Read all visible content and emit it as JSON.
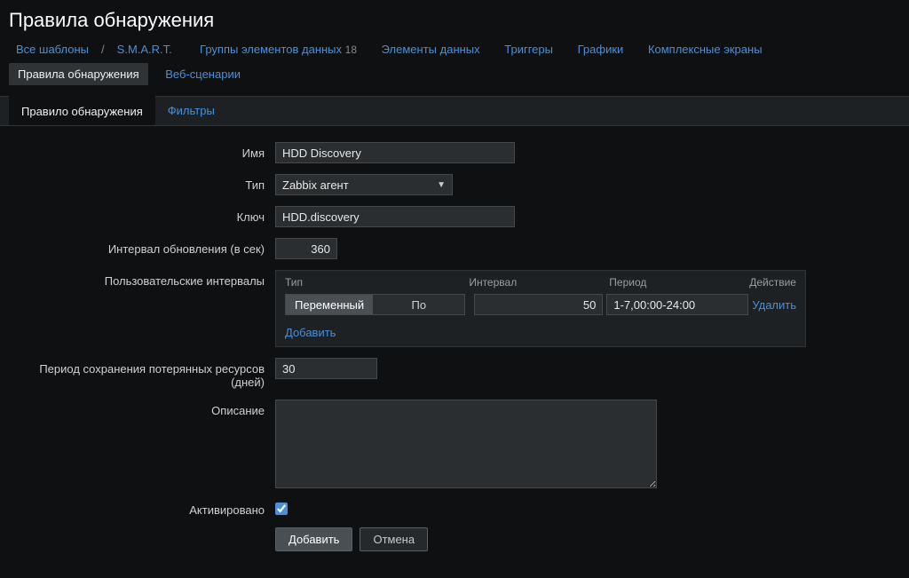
{
  "page": {
    "title": "Правила обнаружения"
  },
  "breadcrumb": {
    "all_templates": "Все шаблоны",
    "template_name": "S.M.A.R.T.",
    "data_groups": "Группы элементов данных",
    "data_groups_count": "18",
    "data_items": "Элементы данных",
    "triggers": "Триггеры",
    "graphs": "Графики",
    "screens": "Комплексные экраны",
    "discovery_rules": "Правила обнаружения",
    "web": "Веб-сценарии"
  },
  "tabs": {
    "rule": "Правило обнаружения",
    "filters": "Фильтры"
  },
  "form": {
    "name_label": "Имя",
    "name_value": "HDD Discovery",
    "type_label": "Тип",
    "type_value": "Zabbix агент",
    "key_label": "Ключ",
    "key_value": "HDD.discovery",
    "update_interval_label": "Интервал обновления (в сек)",
    "update_interval_value": "360",
    "custom_intervals_label": "Пользовательские интервалы",
    "ci_head_type": "Тип",
    "ci_head_interval": "Интервал",
    "ci_head_period": "Период",
    "ci_head_action": "Действие",
    "ci_seg_variable": "Переменный",
    "ci_seg_schedule": "По расписанию",
    "ci_interval_value": "50",
    "ci_period_value": "1-7,00:00-24:00",
    "ci_delete": "Удалить",
    "ci_add": "Добавить",
    "keep_lost_label": "Период сохранения потерянных ресурсов (дней)",
    "keep_lost_value": "30",
    "description_label": "Описание",
    "description_value": "",
    "enabled_label": "Активировано",
    "btn_add": "Добавить",
    "btn_cancel": "Отмена"
  }
}
